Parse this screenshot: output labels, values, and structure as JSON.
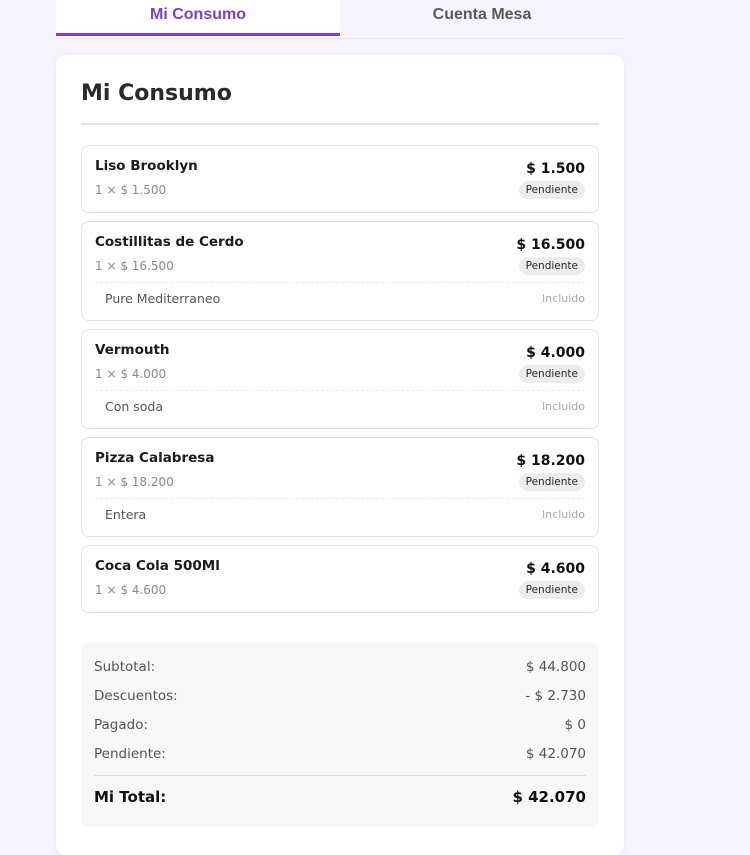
{
  "tabs": [
    {
      "label": "Mi Consumo",
      "active": true
    },
    {
      "label": "Cuenta Mesa",
      "active": false
    }
  ],
  "title": "Mi Consumo",
  "items": [
    {
      "name": "Liso Brooklyn",
      "qty": "1 × $ 1.500",
      "price": "$ 1.500",
      "status": "Pendiente"
    },
    {
      "name": "Costillitas de Cerdo",
      "qty": "1 × $ 16.500",
      "price": "$ 16.500",
      "status": "Pendiente",
      "modifier": {
        "name": "Pure Mediterraneo",
        "status": "Incluido"
      }
    },
    {
      "name": "Vermouth",
      "qty": "1 × $ 4.000",
      "price": "$ 4.000",
      "status": "Pendiente",
      "modifier": {
        "name": "Con soda",
        "status": "Incluido"
      }
    },
    {
      "name": "Pizza Calabresa",
      "qty": "1 × $ 18.200",
      "price": "$ 18.200",
      "status": "Pendiente",
      "modifier": {
        "name": "Entera",
        "status": "Incluido"
      }
    },
    {
      "name": "Coca Cola 500Ml",
      "qty": "1 × $ 4.600",
      "price": "$ 4.600",
      "status": "Pendiente"
    }
  ],
  "summary": {
    "subtotal_label": "Subtotal:",
    "subtotal_value": "$ 44.800",
    "discounts_label": "Descuentos:",
    "discounts_value": "- $ 2.730",
    "paid_label": "Pagado:",
    "paid_value": "$ 0",
    "pending_label": "Pendiente:",
    "pending_value": "$ 42.070",
    "total_label": "Mi Total:",
    "total_value": "$ 42.070"
  },
  "colors": {
    "accent": "#7b3fd4",
    "background": "#f6f3fd"
  }
}
